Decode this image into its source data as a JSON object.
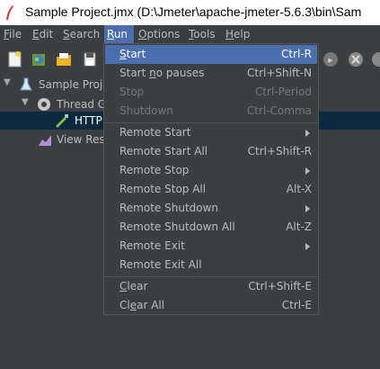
{
  "window": {
    "title": "Sample Project.jmx (D:\\Jmeter\\apache-jmeter-5.6.3\\bin\\Sam"
  },
  "menubar": [
    {
      "label": "File",
      "mnemonic": "F",
      "rest": "ile"
    },
    {
      "label": "Edit",
      "mnemonic": "E",
      "rest": "dit"
    },
    {
      "label": "Search",
      "mnemonic": "S",
      "rest": "earch"
    },
    {
      "label": "Run",
      "mnemonic": "R",
      "rest": "un"
    },
    {
      "label": "Options",
      "mnemonic": "O",
      "rest": "ptions"
    },
    {
      "label": "Tools",
      "mnemonic": "T",
      "rest": "ools"
    },
    {
      "label": "Help",
      "mnemonic": "H",
      "rest": "elp"
    }
  ],
  "tree": [
    {
      "label": "Sample Projec",
      "icon": "flask-icon"
    },
    {
      "label": "Thread Gro",
      "icon": "gear-icon"
    },
    {
      "label": "HTTP",
      "icon": "pipette-icon"
    },
    {
      "label": "View Resul",
      "icon": "chart-icon"
    }
  ],
  "run_menu": [
    {
      "pre": "",
      "mn": "S",
      "post": "tart",
      "acc": "Ctrl-R",
      "highlighted": true
    },
    {
      "pre": "Start ",
      "mn": "n",
      "post": "o pauses",
      "acc": "Ctrl+Shift-N"
    },
    {
      "pre": "Stop",
      "mn": "",
      "post": "",
      "acc": "Ctrl-Period",
      "disabled": true
    },
    {
      "pre": "Shutdown",
      "mn": "",
      "post": "",
      "acc": "Ctrl-Comma",
      "disabled": true
    },
    {
      "pre": "Remote Start",
      "mn": "",
      "post": "",
      "acc": "",
      "submenu": true
    },
    {
      "pre": "Remote Start All",
      "mn": "",
      "post": "",
      "acc": "Ctrl+Shift-R"
    },
    {
      "pre": "Remote Stop",
      "mn": "",
      "post": "",
      "acc": "",
      "submenu": true
    },
    {
      "pre": "Remote Stop All",
      "mn": "",
      "post": "",
      "acc": "Alt-X"
    },
    {
      "pre": "Remote Shutdown",
      "mn": "",
      "post": "",
      "acc": "",
      "submenu": true
    },
    {
      "pre": "Remote Shutdown All",
      "mn": "",
      "post": "",
      "acc": "Alt-Z"
    },
    {
      "pre": "Remote Exit",
      "mn": "",
      "post": "",
      "acc": "",
      "submenu": true
    },
    {
      "pre": "Remote Exit All",
      "mn": "",
      "post": "",
      "acc": ""
    },
    {
      "pre": "",
      "mn": "C",
      "post": "lear",
      "acc": "Ctrl+Shift-E"
    },
    {
      "pre": "Cl",
      "mn": "e",
      "post": "ar All",
      "acc": "Ctrl-E"
    }
  ],
  "colors": {
    "background": "#3c3f41",
    "highlight": "#4b6eaf",
    "selected_row": "#0d293e",
    "menu_border": "#555555"
  }
}
